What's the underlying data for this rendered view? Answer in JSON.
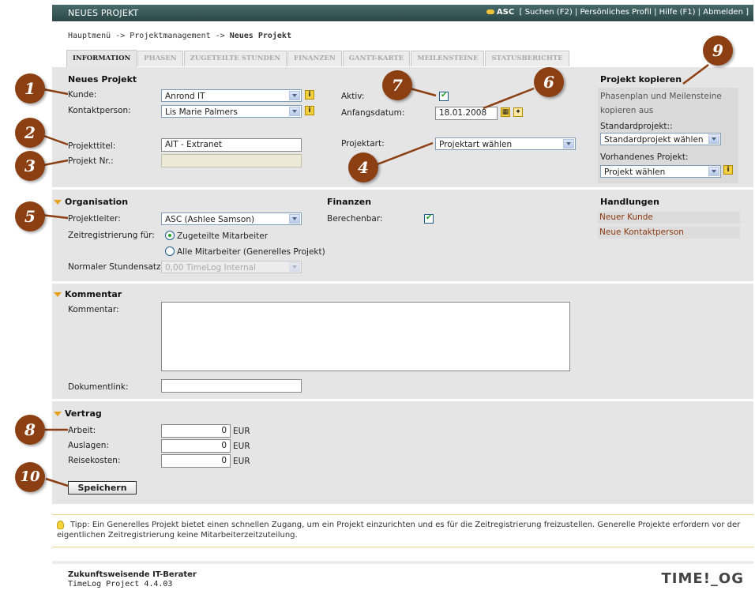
{
  "header": {
    "title": "NEUES PROJEKT",
    "user": "ASC",
    "links": "[ Suchen (F2) | Persönliches Profil | Hilfe (F1) | Abmelden ]"
  },
  "breadcrumb": {
    "path": "Hauptmenü -> Projektmanagement -> ",
    "current": "Neues Projekt"
  },
  "tabs": [
    {
      "label": "INFORMATION",
      "active": true
    },
    {
      "label": "PHASEN"
    },
    {
      "label": "ZUGETEILTE STUNDEN"
    },
    {
      "label": "FINANZEN"
    },
    {
      "label": "GANTT-KARTE"
    },
    {
      "label": "MEILENSTEINE"
    },
    {
      "label": "STATUSBERICHTE"
    }
  ],
  "project": {
    "heading": "Neues Projekt",
    "kunde_label": "Kunde:",
    "kunde_value": "Anrond IT",
    "kontakt_label": "Kontaktperson:",
    "kontakt_value": "Lis Marie Palmers",
    "titel_label": "Projekttitel:",
    "titel_value": "AIT  - Extranet",
    "nr_label": "Projekt Nr.:",
    "nr_value": "",
    "aktiv_label": "Aktiv:",
    "datum_label": "Anfangsdatum:",
    "datum_value": "18.01.2008",
    "art_label": "Projektart:",
    "art_value": "Projektart wählen"
  },
  "copy": {
    "heading": "Projekt kopieren",
    "desc1": "Phasenplan und Meilensteine",
    "desc2": "kopieren aus",
    "standard_label": "Standardprojekt::",
    "standard_value": "Standardprojekt wählen",
    "existing_label": "Vorhandenes Projekt:",
    "existing_value": "Projekt wählen"
  },
  "organisation": {
    "heading": "Organisation",
    "leiter_label": "Projektleiter:",
    "leiter_value": "ASC (Ashlee Samson)",
    "zeit_label": "Zeitregistrierung für:",
    "opt1": "Zugeteilte Mitarbeiter",
    "opt2": "Alle Mitarbeiter (Generelles Projekt)",
    "satz_label": "Normaler Stundensatz:",
    "satz_value": "0,00 TimeLog Internal"
  },
  "finanzen": {
    "heading": "Finanzen",
    "berechenbar_label": "Berechenbar:"
  },
  "handlungen": {
    "heading": "Handlungen",
    "items": [
      "Neuer Kunde",
      "Neue Kontaktperson"
    ]
  },
  "kommentar": {
    "heading": "Kommentar",
    "label": "Kommentar:",
    "value": "",
    "doklink_label": "Dokumentlink:",
    "doklink_value": ""
  },
  "vertrag": {
    "heading": "Vertrag",
    "rows": [
      {
        "label": "Arbeit:",
        "value": "0",
        "unit": "EUR"
      },
      {
        "label": "Auslagen:",
        "value": "0",
        "unit": "EUR"
      },
      {
        "label": "Reisekosten:",
        "value": "0",
        "unit": "EUR"
      }
    ]
  },
  "save_label": "Speichern",
  "tip": "Tipp: Ein Generelles Projekt bietet einen schnellen Zugang, um ein Projekt einzurichten und es für die Zeitregistrierung freizustellen. Generelle Projekte erfordern vor der eigentlichen Zeitregistrierung keine Mitarbeiterzeitzuteilung.",
  "footer": {
    "company": "Zukunftsweisende IT-Berater",
    "version": "TimeLog Project 4.4.03",
    "logo": "TIME!_OG"
  },
  "callouts": [
    "1",
    "2",
    "3",
    "4",
    "5",
    "6",
    "7",
    "8",
    "9",
    "10"
  ],
  "colors": {
    "header": "#2f4f4f",
    "panel": "#e5e5e5",
    "callout": "#8b3f12",
    "accent_triangle": "#e7a11c",
    "action_link": "#8a3a12"
  }
}
